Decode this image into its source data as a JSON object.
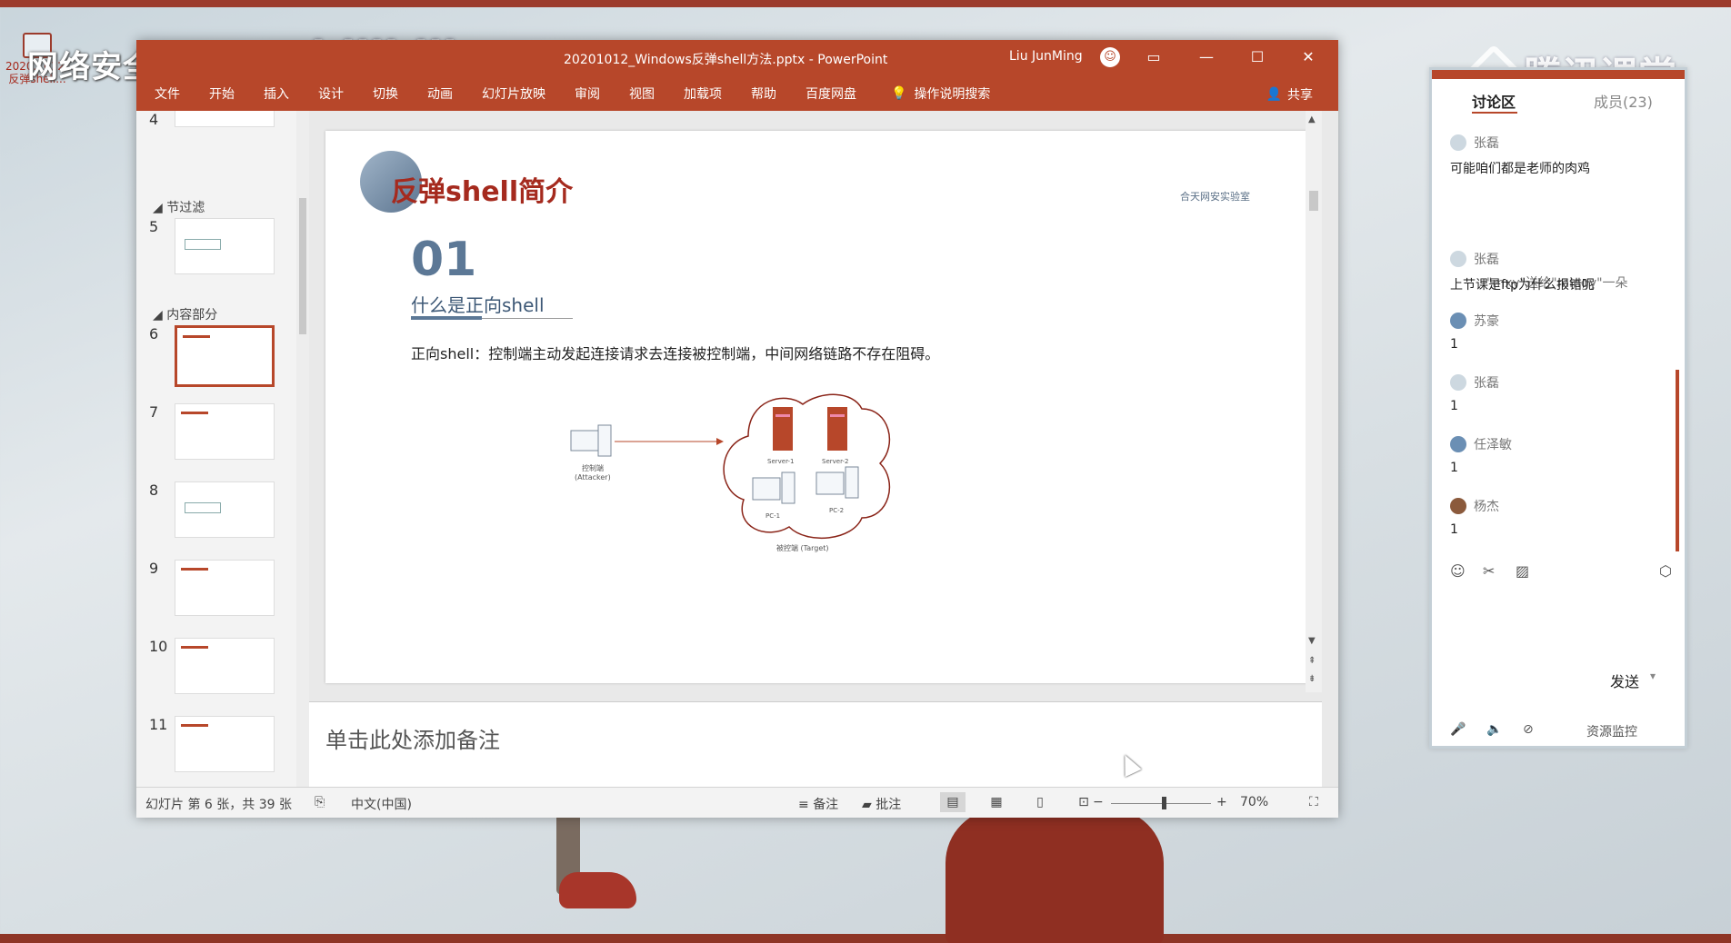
{
  "desktop": {
    "icon_label_1": "2020.1012...",
    "icon_label_2": "反弹shell...",
    "promo_text": "网络安全就业推荐",
    "bilibili": "bilibili",
    "tencent": "腾讯课堂"
  },
  "window": {
    "title": "20201012_Windows反弹shell方法.pptx  -  PowerPoint",
    "user": "Liu JunMing",
    "controls": {
      "ribbon_display": "▭",
      "minimize": "—",
      "maximize": "☐",
      "close": "✕"
    }
  },
  "ribbon": {
    "tabs": [
      "文件",
      "开始",
      "插入",
      "设计",
      "切换",
      "动画",
      "幻灯片放映",
      "审阅",
      "视图",
      "加载项",
      "帮助",
      "百度网盘"
    ],
    "tell_me": "操作说明搜索",
    "share": "共享"
  },
  "thumbnails": {
    "sections": [
      "节过滤",
      "内容部分"
    ],
    "slides": [
      "4",
      "5",
      "6",
      "7",
      "8",
      "9",
      "10",
      "11"
    ],
    "selected": "6"
  },
  "slide": {
    "title": "反弹shell简介",
    "logo_text": "合天网安实验室",
    "number": "01",
    "subtitle": "什么是正向shell",
    "body": "正向shell：控制端主动发起连接请求去连接被控制端，中间网络链路不存在阻碍。",
    "diagram": {
      "attacker_label": "控制端",
      "attacker_sub": "(Attacker)",
      "server1": "Server-1",
      "server2": "Server-2",
      "pc1": "PC-1",
      "pc2": "PC-2",
      "target_label": "被控端 (Target)"
    }
  },
  "notes": {
    "placeholder": "单击此处添加备注"
  },
  "statusbar": {
    "slide_info": "幻灯片 第 6 张，共 39 张",
    "language": "中文(中国)",
    "notes": "备注",
    "comments": "批注",
    "zoom_level": 70,
    "zoom": "70%"
  },
  "chat": {
    "tab_discuss": "讨论区",
    "tab_members": "成员(23)",
    "messages": [
      {
        "user": "张磊",
        "text": "可能咱们都是老师的肉鸡"
      },
      {
        "user": "张磊",
        "text": "上节课是ftp为什么报错呢"
      },
      {
        "user": "苏豪",
        "text": "1"
      },
      {
        "user": "张磊",
        "text": "1"
      },
      {
        "user": "任泽敏",
        "text": "1"
      },
      {
        "user": "杨杰",
        "text": "1"
      }
    ],
    "system": "\"mxy\"送给\"mingy\"一朵",
    "send": "发送",
    "resource_monitor": "资源监控"
  }
}
